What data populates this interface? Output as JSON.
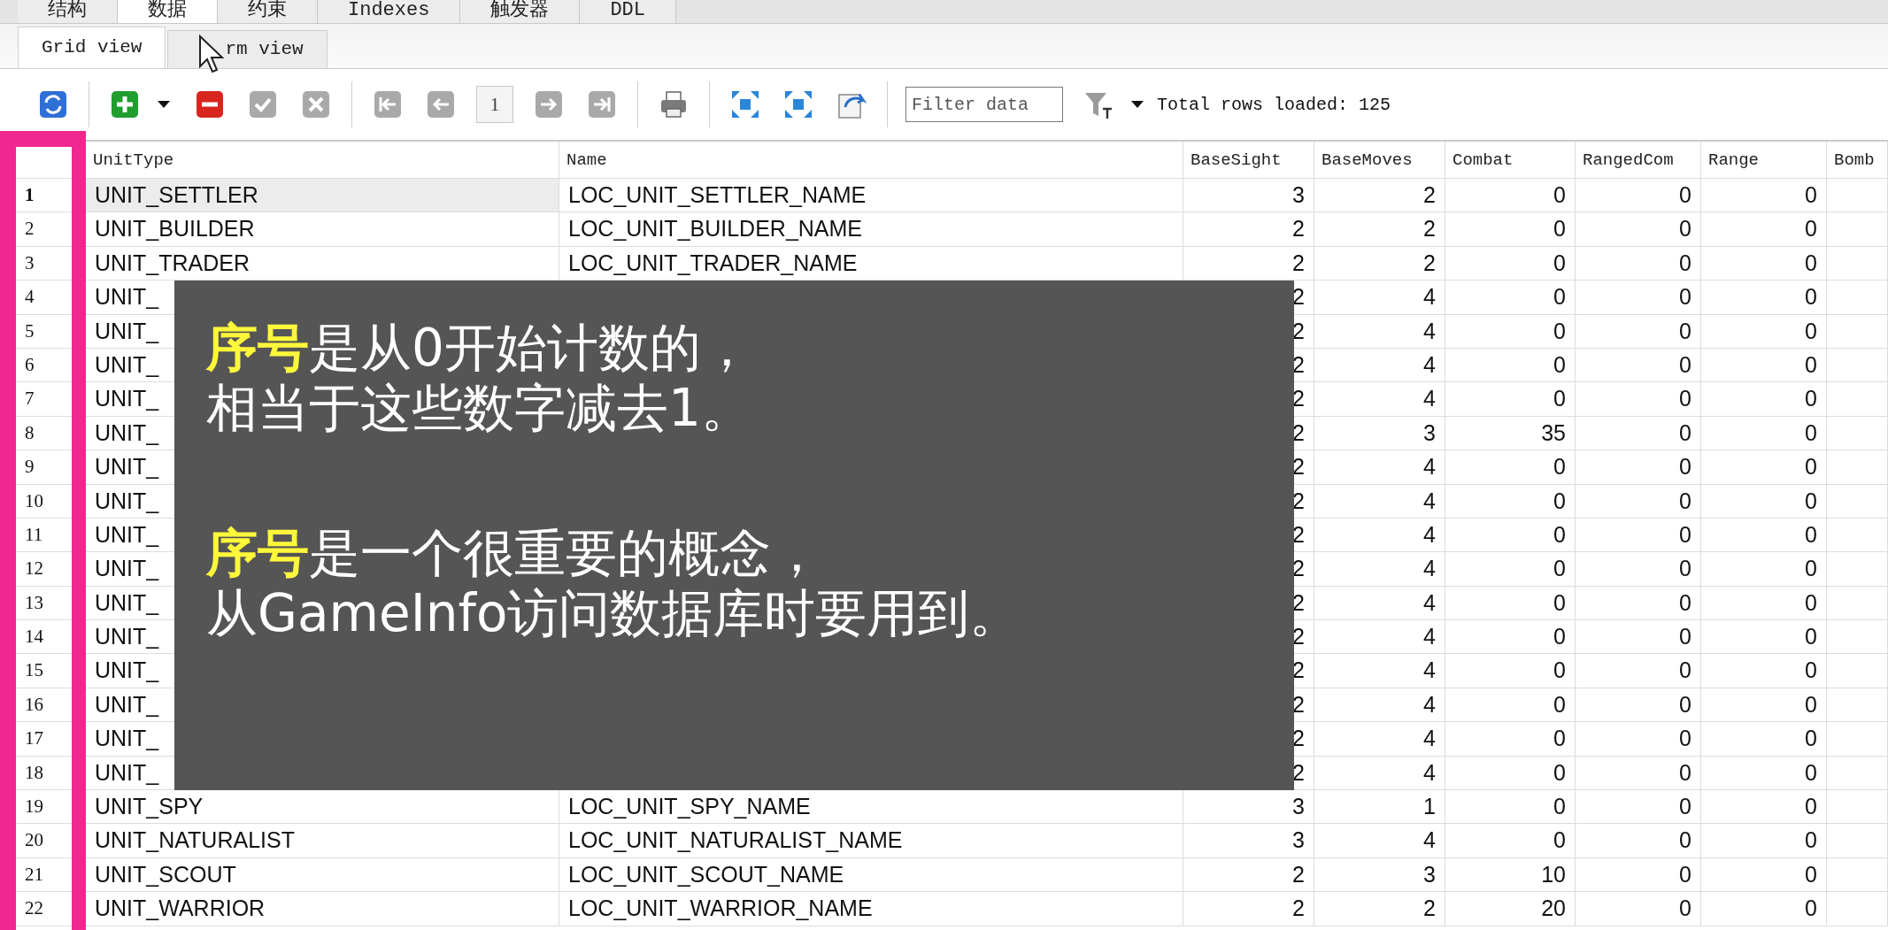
{
  "tabs": [
    {
      "label": "结构",
      "selected": false
    },
    {
      "label": "数据",
      "selected": true
    },
    {
      "label": "约束",
      "selected": false
    },
    {
      "label": "Indexes",
      "selected": false
    },
    {
      "label": "触发器",
      "selected": false
    },
    {
      "label": "DDL",
      "selected": false
    }
  ],
  "view_tabs": [
    {
      "label": "Grid view",
      "selected": true
    },
    {
      "label": "rm view",
      "selected": false
    }
  ],
  "toolbar": {
    "items": [
      {
        "kind": "refresh",
        "disabled": false
      },
      {
        "kind": "add",
        "disabled": false
      },
      {
        "kind": "caret",
        "disabled": false
      },
      {
        "kind": "delete",
        "disabled": false
      },
      {
        "kind": "commit",
        "disabled": true
      },
      {
        "kind": "rollback",
        "disabled": true
      },
      {
        "kind": "first",
        "disabled": true
      },
      {
        "kind": "prev",
        "disabled": true
      },
      {
        "kind": "page",
        "value": "1"
      },
      {
        "kind": "next",
        "disabled": true
      },
      {
        "kind": "last",
        "disabled": true
      },
      {
        "kind": "print",
        "disabled": false
      },
      {
        "kind": "expand",
        "disabled": false
      },
      {
        "kind": "collapse",
        "disabled": false
      },
      {
        "kind": "export"
      },
      {
        "kind": "filter",
        "placeholder": "Filter data"
      },
      {
        "kind": "filter-mode"
      },
      {
        "kind": "caret",
        "disabled": false
      },
      {
        "kind": "status",
        "text": "Total rows loaded: 125"
      }
    ]
  },
  "table": {
    "columns": [
      {
        "label": "UnitType",
        "kind": "text"
      },
      {
        "label": "Name",
        "kind": "text"
      },
      {
        "label": "BaseSight",
        "kind": "number"
      },
      {
        "label": "BaseMoves",
        "kind": "number"
      },
      {
        "label": "Combat",
        "kind": "number"
      },
      {
        "label": "RangedCom",
        "kind": "number"
      },
      {
        "label": "Range",
        "kind": "number"
      },
      {
        "label": "Bomb",
        "kind": "number"
      }
    ],
    "rows": [
      {
        "number": "1",
        "selected": true,
        "cells": [
          "UNIT_SETTLER",
          "LOC_UNIT_SETTLER_NAME",
          "3",
          "2",
          "0",
          "0",
          "0"
        ]
      },
      {
        "number": "2",
        "selected": false,
        "cells": [
          "UNIT_BUILDER",
          "LOC_UNIT_BUILDER_NAME",
          "2",
          "2",
          "0",
          "0",
          "0"
        ]
      },
      {
        "number": "3",
        "selected": false,
        "cells": [
          "UNIT_TRADER",
          "LOC_UNIT_TRADER_NAME",
          "2",
          "2",
          "0",
          "0",
          "0"
        ]
      },
      {
        "number": "4",
        "selected": false,
        "cells": [
          "UNIT_",
          null,
          "2",
          "4",
          "0",
          "0",
          "0"
        ]
      },
      {
        "number": "5",
        "selected": false,
        "cells": [
          "UNIT_",
          null,
          "2",
          "4",
          "0",
          "0",
          "0"
        ]
      },
      {
        "number": "6",
        "selected": false,
        "cells": [
          "UNIT_",
          null,
          "2",
          "4",
          "0",
          "0",
          "0"
        ]
      },
      {
        "number": "7",
        "selected": false,
        "cells": [
          "UNIT_",
          null,
          "2",
          "4",
          "0",
          "0",
          "0"
        ]
      },
      {
        "number": "8",
        "selected": false,
        "cells": [
          "UNIT_",
          null,
          "2",
          "3",
          "35",
          "0",
          "0"
        ]
      },
      {
        "number": "9",
        "selected": false,
        "cells": [
          "UNIT_",
          null,
          "2",
          "4",
          "0",
          "0",
          "0"
        ]
      },
      {
        "number": "10",
        "selected": false,
        "cells": [
          "UNIT_",
          null,
          "2",
          "4",
          "0",
          "0",
          "0"
        ]
      },
      {
        "number": "11",
        "selected": false,
        "cells": [
          "UNIT_",
          null,
          "2",
          "4",
          "0",
          "0",
          "0"
        ]
      },
      {
        "number": "12",
        "selected": false,
        "cells": [
          "UNIT_",
          null,
          "2",
          "4",
          "0",
          "0",
          "0"
        ]
      },
      {
        "number": "13",
        "selected": false,
        "cells": [
          "UNIT_",
          null,
          "2",
          "4",
          "0",
          "0",
          "0"
        ]
      },
      {
        "number": "14",
        "selected": false,
        "cells": [
          "UNIT_",
          null,
          "2",
          "4",
          "0",
          "0",
          "0"
        ]
      },
      {
        "number": "15",
        "selected": false,
        "cells": [
          "UNIT_",
          null,
          "2",
          "4",
          "0",
          "0",
          "0"
        ]
      },
      {
        "number": "16",
        "selected": false,
        "cells": [
          "UNIT_",
          null,
          "2",
          "4",
          "0",
          "0",
          "0"
        ]
      },
      {
        "number": "17",
        "selected": false,
        "cells": [
          "UNIT_",
          null,
          "2",
          "4",
          "0",
          "0",
          "0"
        ]
      },
      {
        "number": "18",
        "selected": false,
        "cells": [
          "UNIT_",
          null,
          "2",
          "4",
          "0",
          "0",
          "0"
        ]
      },
      {
        "number": "19",
        "selected": false,
        "cells": [
          "UNIT_SPY",
          "LOC_UNIT_SPY_NAME",
          "3",
          "1",
          "0",
          "0",
          "0"
        ]
      },
      {
        "number": "20",
        "selected": false,
        "cells": [
          "UNIT_NATURALIST",
          "LOC_UNIT_NATURALIST_NAME",
          "3",
          "4",
          "0",
          "0",
          "0"
        ]
      },
      {
        "number": "21",
        "selected": false,
        "cells": [
          "UNIT_SCOUT",
          "LOC_UNIT_SCOUT_NAME",
          "2",
          "3",
          "10",
          "0",
          "0"
        ]
      },
      {
        "number": "22",
        "selected": false,
        "cells": [
          "UNIT_WARRIOR",
          "LOC_UNIT_WARRIOR_NAME",
          "2",
          "2",
          "20",
          "0",
          "0"
        ]
      }
    ]
  },
  "caption": {
    "paragraphs": [
      [
        "**序号**是从0开始计数的，",
        "相当于这些数字减去1。"
      ],
      [
        "**序号**是一个很重要的概念，",
        "从GameInfo访问数据库时要用到。"
      ]
    ]
  }
}
